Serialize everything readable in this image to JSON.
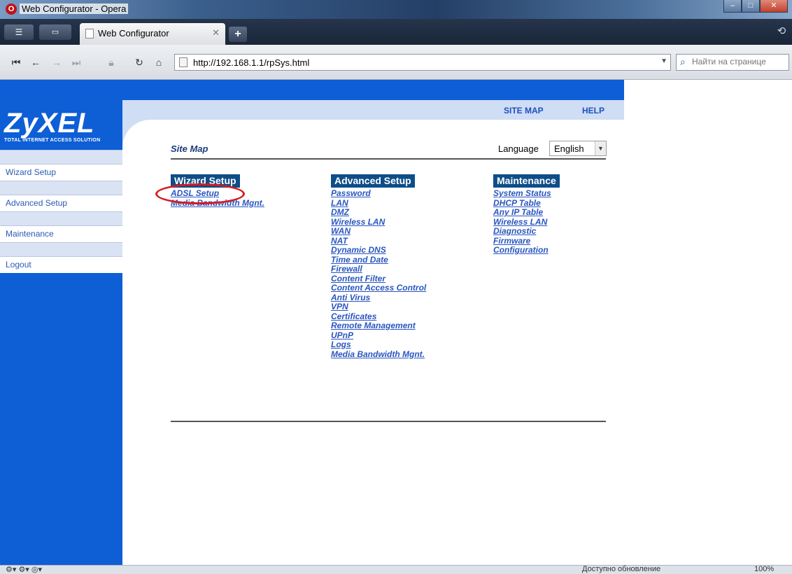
{
  "browser": {
    "window_title": "Web Configurator - Opera",
    "menu_label": "☰",
    "tab_label": "Web Configurator",
    "url": "http://192.168.1.1/rpSys.html",
    "search_placeholder": "Найти на странице",
    "status_update": "Доступно обновление",
    "zoom": "100%"
  },
  "zyxel": {
    "logo": "ZyXEL",
    "tagline": "TOTAL INTERNET ACCESS SOLUTION",
    "header_links": [
      "SITE MAP",
      "HELP"
    ],
    "sidebar": [
      "Wizard Setup",
      "Advanced Setup",
      "Maintenance",
      "Logout"
    ],
    "page_title": "Site Map",
    "language_label": "Language",
    "language_value": "English",
    "columns": [
      {
        "heading": "Wizard Setup",
        "links": [
          "ADSL Setup",
          "Media Bandwidth Mgnt."
        ]
      },
      {
        "heading": "Advanced Setup",
        "links": [
          "Password",
          "LAN",
          "DMZ",
          "Wireless LAN",
          "WAN",
          "NAT",
          "Dynamic DNS",
          "Time and Date",
          "Firewall",
          "Content Filter",
          "Content Access Control",
          "Anti Virus",
          "VPN",
          "Certificates",
          "Remote Management",
          "UPnP",
          "Logs",
          "Media Bandwidth Mgnt."
        ]
      },
      {
        "heading": "Maintenance",
        "links": [
          "System Status",
          "DHCP Table",
          "Any IP Table",
          "Wireless LAN",
          "Diagnostic",
          "Firmware",
          "Configuration"
        ]
      }
    ],
    "highlight_color": "#d61a22",
    "brand_color": "#0e5ed6"
  }
}
